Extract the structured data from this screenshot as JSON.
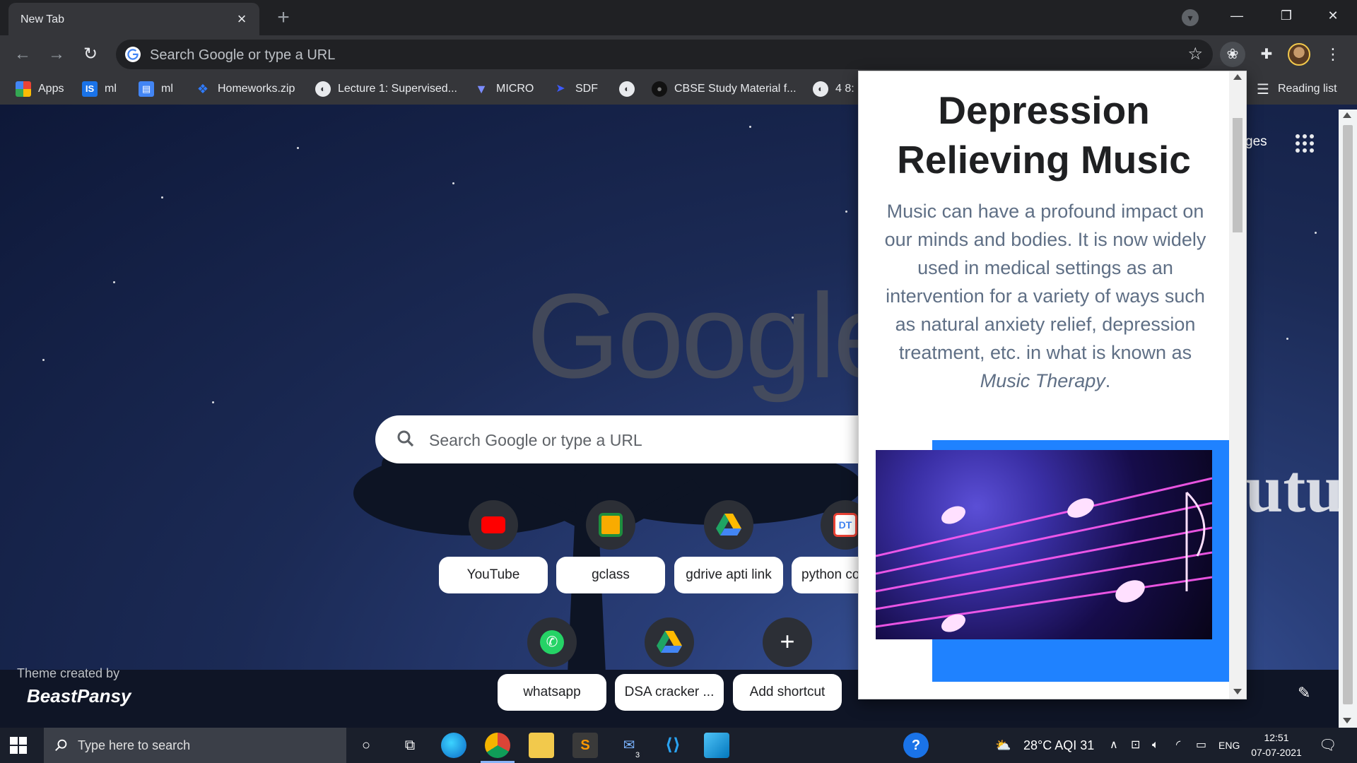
{
  "browser": {
    "tab_title": "New Tab",
    "omnibox_placeholder": "Search Google or type a URL"
  },
  "bookmarks": [
    {
      "label": "Apps",
      "icon": "apps-grid-icon"
    },
    {
      "label": "ml",
      "icon": "is-icon"
    },
    {
      "label": "ml",
      "icon": "doc-icon"
    },
    {
      "label": "Homeworks.zip",
      "icon": "dropbox-icon"
    },
    {
      "label": "Lecture 1: Supervised...",
      "icon": "globe-icon"
    },
    {
      "label": "MICRO",
      "icon": "micro-icon"
    },
    {
      "label": "SDF",
      "icon": "sdf-icon"
    },
    {
      "label": "",
      "icon": "globe-icon"
    },
    {
      "label": "CBSE Study Material f...",
      "icon": "cbse-icon"
    },
    {
      "label": "4 8:",
      "icon": "globe-icon"
    }
  ],
  "reading_list": "Reading list",
  "ntp": {
    "logo": "Google",
    "search_placeholder": "Search Google or type a URL",
    "images_link_partial": "ges",
    "theme_created_by": "Theme created by",
    "theme_brand": "BeastPansy",
    "background_text": "uture",
    "shortcuts": [
      {
        "label": "YouTube",
        "icon": "youtube-icon",
        "color": "#ff0000"
      },
      {
        "label": "gclass",
        "icon": "google-classroom-icon",
        "color": "#f9ab00"
      },
      {
        "label": "gdrive apti link",
        "icon": "google-drive-icon",
        "color": "#1fa463"
      },
      {
        "label": "python co",
        "icon": "dt-icon",
        "color": "#e94235"
      },
      {
        "label": "whatsapp",
        "icon": "whatsapp-icon",
        "color": "#25d366"
      },
      {
        "label": "DSA cracker ...",
        "icon": "google-drive-icon",
        "color": "#1fa463"
      },
      {
        "label": "Add shortcut",
        "icon": "plus-icon",
        "color": "#ffffff"
      }
    ]
  },
  "popup": {
    "title": "Depression Relieving Music",
    "body": "Music can have a profound impact on our minds and bodies. It is now widely used in medical settings as an intervention for a variety of ways such as natural anxiety relief, depression treatment, etc. in what is known as",
    "body_em": "Music Therapy",
    "body_end": ".",
    "accent_color": "#1f82ff"
  },
  "taskbar": {
    "search_placeholder": "Type here to search",
    "weather": "28°C  AQI 31",
    "language": "ENG",
    "time": "12:51",
    "date": "07-07-2021",
    "mail_badge": "3"
  }
}
